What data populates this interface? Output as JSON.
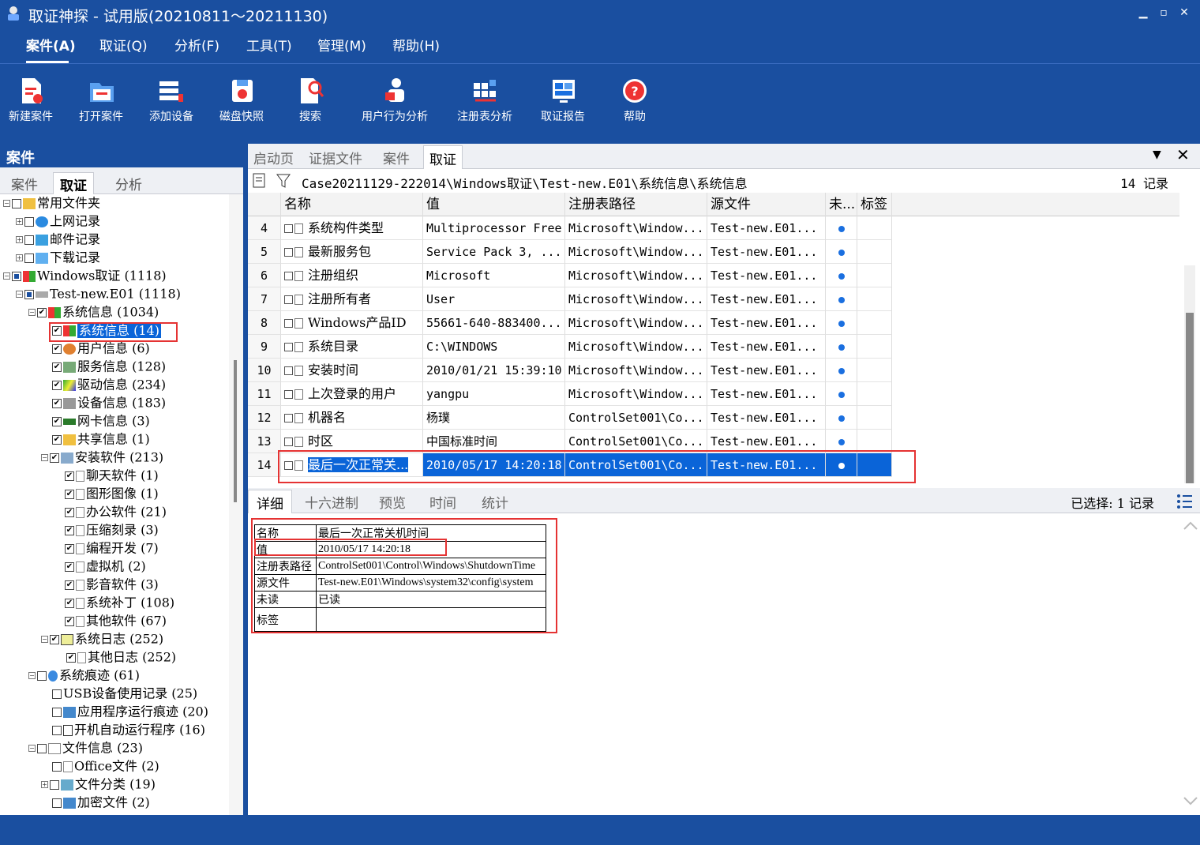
{
  "window": {
    "title": "取证神探 - 试用版(20210811～20211130)",
    "min": "▁",
    "max": "▫",
    "close": "✕"
  },
  "menu": [
    "案件(A)",
    "取证(Q)",
    "分析(F)",
    "工具(T)",
    "管理(M)",
    "帮助(H)"
  ],
  "toolbar": [
    "新建案件",
    "打开案件",
    "添加设备",
    "磁盘快照",
    "搜索",
    "用户行为分析",
    "注册表分析",
    "取证报告",
    "帮助"
  ],
  "left": {
    "header": "案件",
    "tabs": [
      "案件",
      "取证",
      "分析"
    ],
    "tree": [
      {
        "label": "常用文件夹"
      },
      {
        "label": "上网记录"
      },
      {
        "label": "邮件记录"
      },
      {
        "label": "下载记录"
      },
      {
        "label": "Windows取证 (1118)"
      },
      {
        "label": "Test-new.E01 (1118)"
      },
      {
        "label": "系统信息 (1034)"
      },
      {
        "label": "系统信息 (14)"
      },
      {
        "label": "用户信息 (6)"
      },
      {
        "label": "服务信息 (128)"
      },
      {
        "label": "驱动信息 (234)"
      },
      {
        "label": "设备信息 (183)"
      },
      {
        "label": "网卡信息 (3)"
      },
      {
        "label": "共享信息 (1)"
      },
      {
        "label": "安装软件 (213)"
      },
      {
        "label": "聊天软件 (1)"
      },
      {
        "label": "图形图像 (1)"
      },
      {
        "label": "办公软件 (21)"
      },
      {
        "label": "压缩刻录 (3)"
      },
      {
        "label": "编程开发 (7)"
      },
      {
        "label": "虚拟机 (2)"
      },
      {
        "label": "影音软件 (3)"
      },
      {
        "label": "系统补丁 (108)"
      },
      {
        "label": "其他软件 (67)"
      },
      {
        "label": "系统日志 (252)"
      },
      {
        "label": "其他日志 (252)"
      },
      {
        "label": "系统痕迹 (61)"
      },
      {
        "label": "USB设备使用记录 (25)"
      },
      {
        "label": "应用程序运行痕迹 (20)"
      },
      {
        "label": "开机自动运行程序 (16)"
      },
      {
        "label": "文件信息 (23)"
      },
      {
        "label": "Office文件 (2)"
      },
      {
        "label": "文件分类 (19)"
      },
      {
        "label": "加密文件 (2)"
      }
    ]
  },
  "right": {
    "tabs": [
      "启动页",
      "证据文件",
      "案件",
      "取证"
    ],
    "menu_icon": "▼",
    "close_icon": "✕",
    "path": "Case20211129-222014\\Windows取证\\Test-new.E01\\系统信息\\系统信息",
    "count": "14 记录",
    "columns": [
      "名称",
      "值",
      "注册表路径",
      "源文件",
      "未...",
      "标签"
    ],
    "rows": [
      {
        "n": "4",
        "name": "系统构件类型",
        "value": "Multiprocessor Free",
        "reg": "Microsoft\\Window...",
        "src": "Test-new.E01..."
      },
      {
        "n": "5",
        "name": "最新服务包",
        "value": "Service Pack 3, ...",
        "reg": "Microsoft\\Window...",
        "src": "Test-new.E01..."
      },
      {
        "n": "6",
        "name": "注册组织",
        "value": "Microsoft",
        "reg": "Microsoft\\Window...",
        "src": "Test-new.E01..."
      },
      {
        "n": "7",
        "name": "注册所有者",
        "value": "User",
        "reg": "Microsoft\\Window...",
        "src": "Test-new.E01..."
      },
      {
        "n": "8",
        "name": "Windows产品ID",
        "value": "55661-640-883400...",
        "reg": "Microsoft\\Window...",
        "src": "Test-new.E01..."
      },
      {
        "n": "9",
        "name": "系统目录",
        "value": "C:\\WINDOWS",
        "reg": "Microsoft\\Window...",
        "src": "Test-new.E01..."
      },
      {
        "n": "10",
        "name": "安装时间",
        "value": "2010/01/21 15:39:10",
        "reg": "Microsoft\\Window...",
        "src": "Test-new.E01..."
      },
      {
        "n": "11",
        "name": "上次登录的用户",
        "value": "yangpu",
        "reg": "Microsoft\\Window...",
        "src": "Test-new.E01..."
      },
      {
        "n": "12",
        "name": "机器名",
        "value": "杨璞",
        "reg": "ControlSet001\\Co...",
        "src": "Test-new.E01..."
      },
      {
        "n": "13",
        "name": "时区",
        "value": "中国标准时间",
        "reg": "ControlSet001\\Co...",
        "src": "Test-new.E01..."
      },
      {
        "n": "14",
        "name": "最后一次正常关...",
        "value": "2010/05/17 14:20:18",
        "reg": "ControlSet001\\Co...",
        "src": "Test-new.E01..."
      }
    ],
    "detail_tabs": [
      "详细",
      "十六进制",
      "预览",
      "时间",
      "统计"
    ],
    "selected": "已选择: 1 记录",
    "detail": [
      {
        "k": "名称",
        "v": "最后一次正常关机时间"
      },
      {
        "k": "值",
        "v": "2010/05/17 14:20:18"
      },
      {
        "k": "注册表路径",
        "v": "ControlSet001\\Control\\Windows\\ShutdownTime"
      },
      {
        "k": "源文件",
        "v": "Test-new.E01\\Windows\\system32\\config\\system"
      },
      {
        "k": "未读",
        "v": "已读"
      },
      {
        "k": "标签",
        "v": ""
      }
    ]
  }
}
